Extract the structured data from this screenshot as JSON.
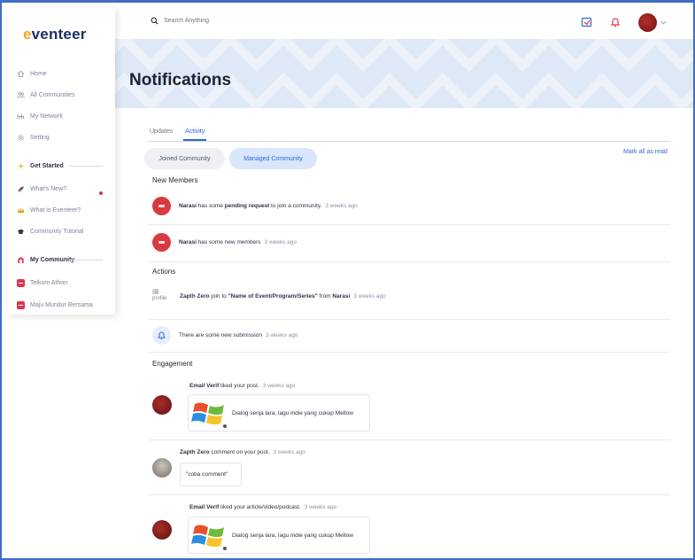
{
  "app": {
    "logo_text": "eventeer",
    "logo_letter": "e"
  },
  "search": {
    "placeholder": "Search Anything"
  },
  "sidebar": {
    "items": [
      {
        "label": "Home",
        "icon": "home-icon"
      },
      {
        "label": "All Communities",
        "icon": "communities-icon"
      },
      {
        "label": "My Network",
        "icon": "network-icon"
      },
      {
        "label": "Setting",
        "icon": "gear-icon"
      }
    ],
    "get_started": "Get Started",
    "get_started_items": [
      {
        "label": "What's New?",
        "icon": "rocket-icon",
        "has_dot": true
      },
      {
        "label": "What is Eventeer?",
        "icon": "crown-icon"
      },
      {
        "label": "Community Tutorial",
        "icon": "graduation-cap-icon"
      }
    ],
    "my_community": "My Community",
    "communities": [
      {
        "label": "Telkom Athon"
      },
      {
        "label": "Maju Mundur Bersama"
      }
    ]
  },
  "page": {
    "title": "Notifications"
  },
  "tabs": [
    {
      "label": "Updates",
      "active": false
    },
    {
      "label": "Activity",
      "active": true
    }
  ],
  "filters": {
    "joined": "Joined Community",
    "managed": "Managed Community",
    "selected": "Managed Community"
  },
  "mark_all": "Mark all as read",
  "sections": {
    "new_members": "New Members",
    "actions": "Actions",
    "engagement": "Engagement"
  },
  "new_members": [
    {
      "name": "Narasi",
      "pre": " has some ",
      "bold": "pending request",
      "post": " to join a community.",
      "time": "3 weeks ago"
    },
    {
      "name": "Narasi",
      "pre": " has some new members",
      "bold": "",
      "post": "",
      "time": "3 weeks ago"
    }
  ],
  "actions": [
    {
      "broken_img_alt": "profile",
      "name": "Zapth Zero",
      "pre": " join to ",
      "bold": "\"Name of Event/Program/Series\"",
      "post": " from ",
      "org": "Narasi",
      "time": "3 weeks ago"
    },
    {
      "text": "There are some new submission",
      "time": "3 weeks ago"
    }
  ],
  "engagement": [
    {
      "name": "Email Verif",
      "action": " liked your post.",
      "time": "3 weeks ago",
      "post_text": "Dialog senja lara, lagu indie yang cukup Mellow"
    },
    {
      "name": "Zapth Zero",
      "action": " comment on your post.",
      "time": "3 weeks ago",
      "comment": "\"coba comment\""
    },
    {
      "name": "Email Verif",
      "action": " liked your article/video/podcast.",
      "time": "3 weeks ago",
      "post_text": "Dialog senja lara, lagu indie yang cukup Mellow"
    }
  ],
  "colors": {
    "accent": "#2c67d8",
    "brand_navy": "#1d2d6b",
    "brand_orange": "#f2a21d",
    "banner": "#dfe8f6",
    "danger": "#d93a3f"
  }
}
